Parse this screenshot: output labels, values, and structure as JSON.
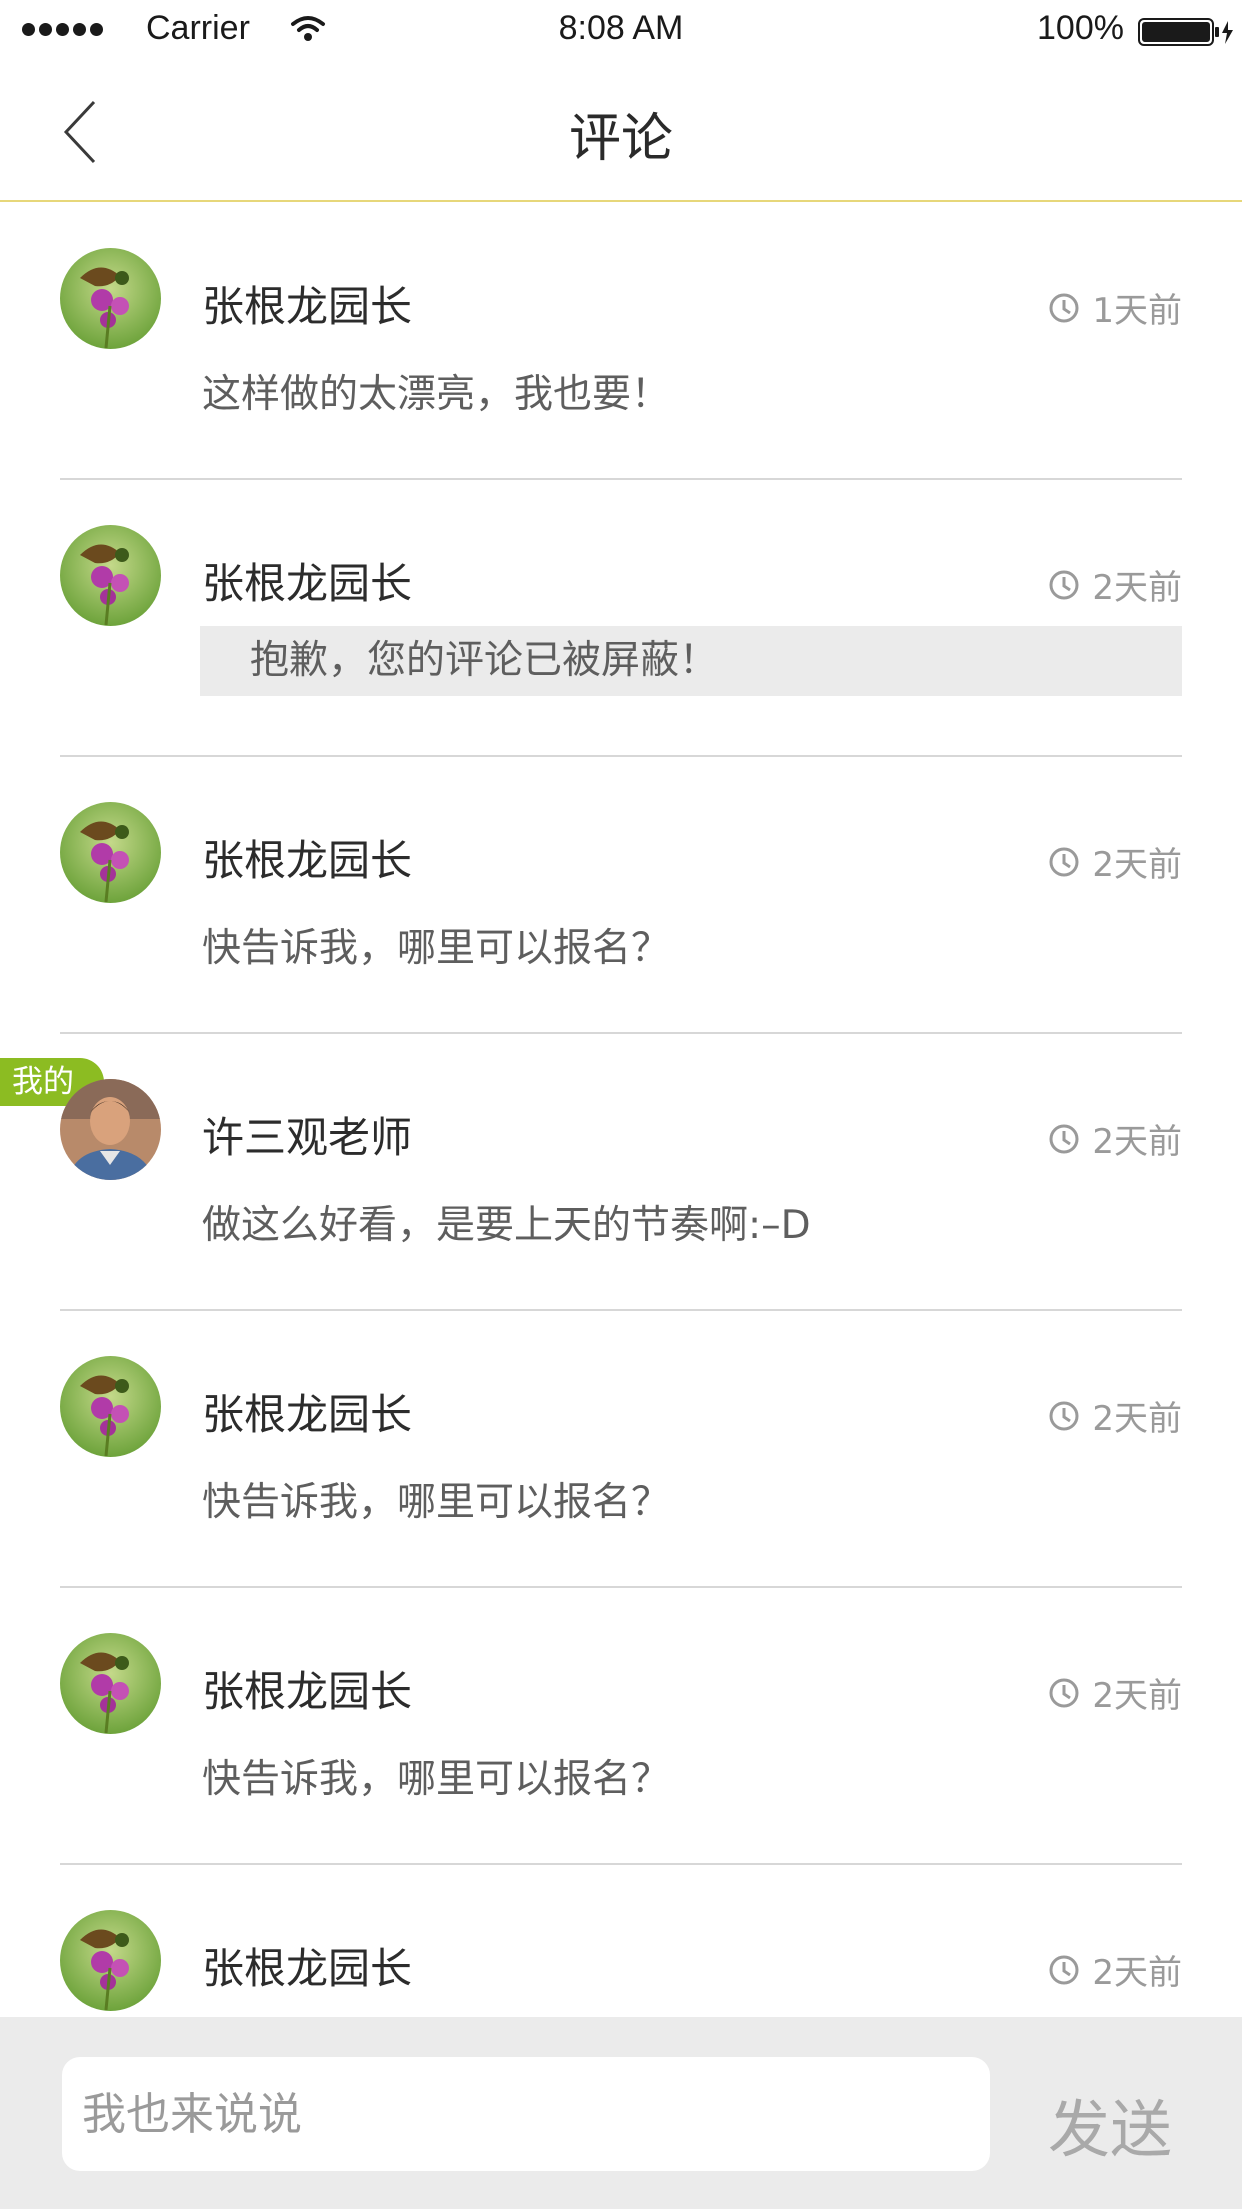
{
  "status_bar": {
    "carrier": "Carrier",
    "time": "8:08 AM",
    "battery": "100%"
  },
  "nav": {
    "title": "评论",
    "back_icon": "chevron-left-icon"
  },
  "comments": [
    {
      "author": "张根龙园长",
      "time": "1天前",
      "text": "这样做的太漂亮，我也要！",
      "blocked": false,
      "mine": false,
      "avatar": "orchid-bird-avatar"
    },
    {
      "author": "张根龙园长",
      "time": "2天前",
      "text": "抱歉，您的评论已被屏蔽！",
      "blocked": true,
      "mine": false,
      "avatar": "orchid-bird-avatar"
    },
    {
      "author": "张根龙园长",
      "time": "2天前",
      "text": "快告诉我，哪里可以报名？",
      "blocked": false,
      "mine": false,
      "avatar": "orchid-bird-avatar"
    },
    {
      "author": "许三观老师",
      "time": "2天前",
      "text": "做这么好看，是要上天的节奏啊:–D",
      "blocked": false,
      "mine": true,
      "mine_label": "我的",
      "avatar": "man-portrait-avatar"
    },
    {
      "author": "张根龙园长",
      "time": "2天前",
      "text": "快告诉我，哪里可以报名？",
      "blocked": false,
      "mine": false,
      "avatar": "orchid-bird-avatar"
    },
    {
      "author": "张根龙园长",
      "time": "2天前",
      "text": "快告诉我，哪里可以报名？",
      "blocked": false,
      "mine": false,
      "avatar": "orchid-bird-avatar"
    },
    {
      "author": "张根龙园长",
      "time": "2天前",
      "text": "",
      "blocked": false,
      "mine": false,
      "avatar": "orchid-bird-avatar"
    }
  ],
  "input": {
    "placeholder": "我也来说说",
    "send_label": "发送"
  },
  "colors": {
    "accent_green": "#8cbc22",
    "nav_divider": "#e7d77a",
    "input_bar_bg": "#ebebeb"
  }
}
